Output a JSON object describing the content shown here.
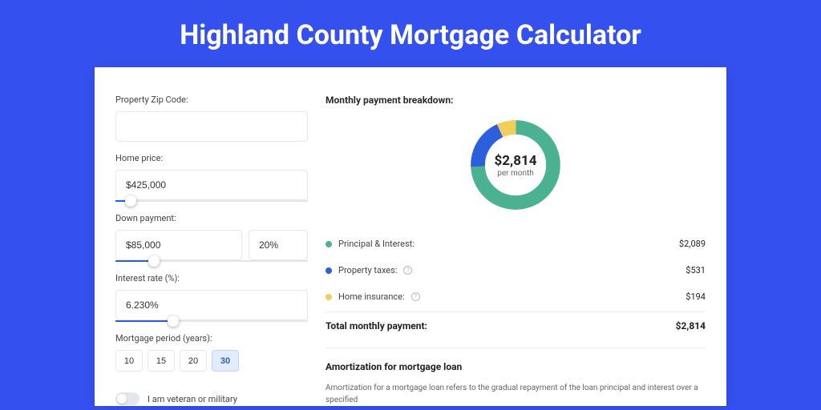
{
  "title": "Highland County Mortgage Calculator",
  "colors": {
    "primary": "#3451ef",
    "pi": "#4bb291",
    "tax": "#2b5fdc",
    "insurance": "#f2cd5d"
  },
  "form": {
    "zip": {
      "label": "Property Zip Code:",
      "value": ""
    },
    "home_price": {
      "label": "Home price:",
      "value": "$425,000",
      "slider_pct": 8
    },
    "down_payment": {
      "label": "Down payment:",
      "amount": "$85,000",
      "percent": "20%",
      "slider_pct": 20
    },
    "interest": {
      "label": "Interest rate (%):",
      "value": "6.230%",
      "slider_pct": 30
    },
    "period": {
      "label": "Mortgage period (years):",
      "options": [
        "10",
        "15",
        "20",
        "30"
      ],
      "selected": "30"
    },
    "veteran": {
      "label": "I am veteran or military",
      "on": false
    }
  },
  "breakdown": {
    "title": "Monthly payment breakdown:",
    "center_amount": "$2,814",
    "center_sub": "per month",
    "items": [
      {
        "key": "pi",
        "label": "Principal & Interest:",
        "value": "$2,089",
        "color": "#4bb291",
        "info": false
      },
      {
        "key": "tax",
        "label": "Property taxes:",
        "value": "$531",
        "color": "#2b5fdc",
        "info": true
      },
      {
        "key": "ins",
        "label": "Home insurance:",
        "value": "$194",
        "color": "#f2cd5d",
        "info": true
      }
    ],
    "total_label": "Total monthly payment:",
    "total_value": "$2,814"
  },
  "amort": {
    "title": "Amortization for mortgage loan",
    "text": "Amortization for a mortgage loan refers to the gradual repayment of the loan principal and interest over a specified"
  },
  "chart_data": {
    "type": "pie",
    "title": "Monthly payment breakdown",
    "categories": [
      "Principal & Interest",
      "Property taxes",
      "Home insurance"
    ],
    "values": [
      2089,
      531,
      194
    ],
    "colors": [
      "#4bb291",
      "#2b5fdc",
      "#f2cd5d"
    ],
    "total": 2814,
    "unit": "USD per month"
  }
}
